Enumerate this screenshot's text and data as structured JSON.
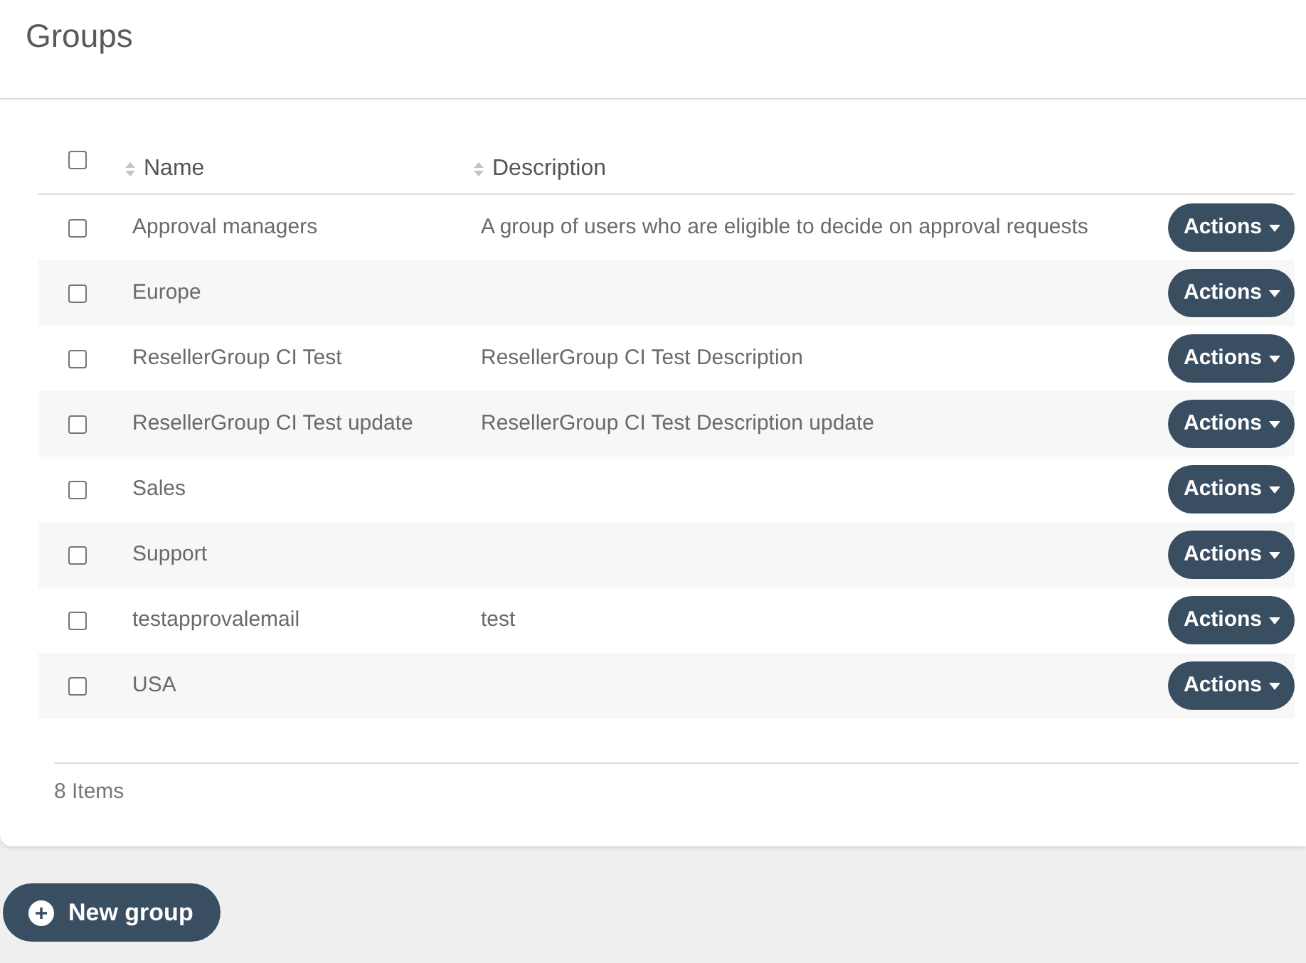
{
  "page": {
    "title": "Groups"
  },
  "table": {
    "select_all": {
      "checked": false
    },
    "columns": [
      {
        "label": "Name",
        "sortable": true
      },
      {
        "label": "Description",
        "sortable": true
      }
    ],
    "rows": [
      {
        "checked": false,
        "name": "Approval managers",
        "description": "A group of users who are eligible to decide on approval requests",
        "action": "Actions"
      },
      {
        "checked": false,
        "name": "Europe",
        "action": "Actions"
      },
      {
        "checked": false,
        "name": "ResellerGroup CI Test",
        "description": "ResellerGroup CI Test Description",
        "action": "Actions"
      },
      {
        "checked": false,
        "name": "ResellerGroup CI Test update",
        "description": "ResellerGroup CI Test Description update",
        "action": "Actions"
      },
      {
        "checked": false,
        "name": "Sales",
        "action": "Actions"
      },
      {
        "checked": false,
        "name": "Support",
        "action": "Actions"
      },
      {
        "checked": false,
        "name": "testapprovalemail",
        "description": "test",
        "action": "Actions"
      },
      {
        "checked": false,
        "name": "USA",
        "action": "Actions"
      }
    ],
    "footer": {
      "count": "8 Items"
    }
  },
  "new_button": {
    "label": "New group"
  }
}
